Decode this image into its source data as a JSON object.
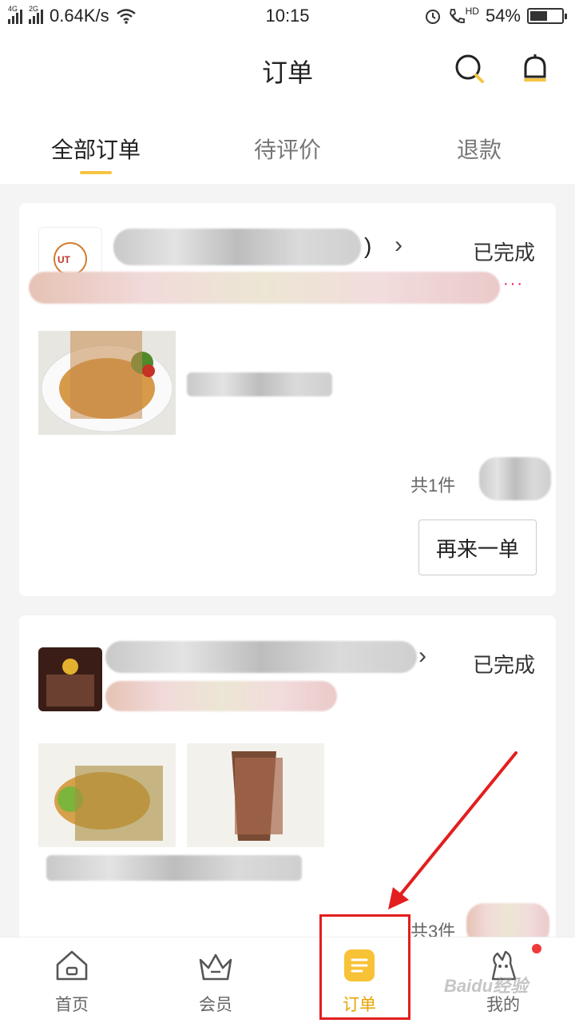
{
  "status_bar": {
    "net_label": "4G",
    "net_label2": "2G",
    "speed": "0.64K/s",
    "time": "10:15",
    "hd": "HD",
    "battery_text": "54%",
    "battery_level": 0.54
  },
  "header": {
    "title": "订单",
    "search_icon": "search-icon",
    "bell_icon": "bell-icon"
  },
  "tabs": [
    {
      "label": "全部订单",
      "active": true
    },
    {
      "label": "待评价",
      "active": false
    },
    {
      "label": "退款",
      "active": false
    }
  ],
  "orders": [
    {
      "name_paren": ")",
      "status": "已完成",
      "dots": "···",
      "count_text": "共1件",
      "reorder_label": "再来一单",
      "logo_text": "UT"
    },
    {
      "status": "已完成",
      "count_text": "共3件"
    }
  ],
  "bottom_nav": [
    {
      "label": "首页",
      "icon": "home-icon",
      "active": false
    },
    {
      "label": "会员",
      "icon": "crown-icon",
      "active": false
    },
    {
      "label": "订单",
      "icon": "order-icon",
      "active": true
    },
    {
      "label": "我的",
      "icon": "profile-icon",
      "active": false
    }
  ],
  "watermark": "Baidu经验",
  "colors": {
    "accent": "#f6c443",
    "active_nav": "#e8a400",
    "annotation": "#e31e1e"
  }
}
